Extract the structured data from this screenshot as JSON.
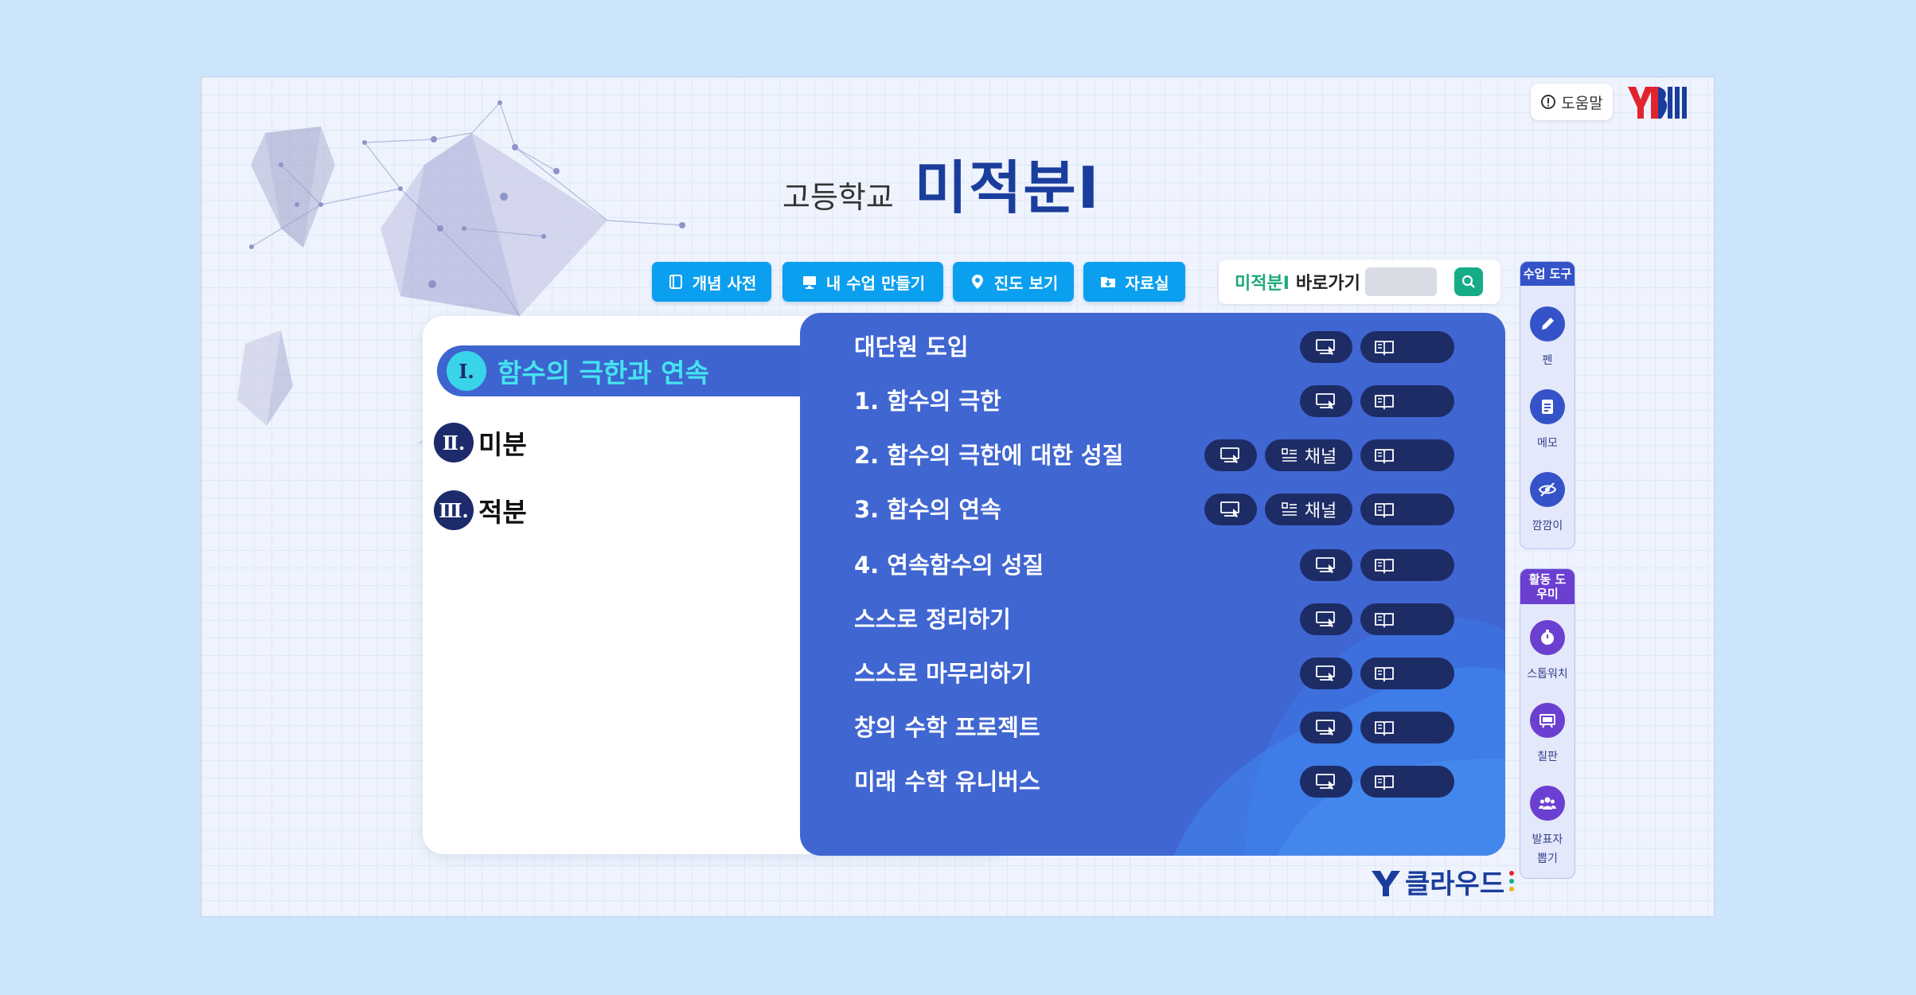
{
  "header": {
    "help_label": "도움말",
    "logo_name": "YBM",
    "title_sub": "고등학교",
    "title_main": "미적분I"
  },
  "toolbar": {
    "buttons": [
      {
        "label": "개념 사전",
        "icon": "book-icon"
      },
      {
        "label": "내 수업 만들기",
        "icon": "monitor-icon"
      },
      {
        "label": "진도 보기",
        "icon": "location-pin-icon"
      },
      {
        "label": "자료실",
        "icon": "folder-download-icon"
      }
    ],
    "search": {
      "subject": "미적분I",
      "label": "바로가기",
      "placeholder": ""
    }
  },
  "chapters": [
    {
      "num": "Ⅰ.",
      "label": "함수의 극한과 연속",
      "active": true
    },
    {
      "num": "Ⅱ.",
      "label": "미분",
      "active": false
    },
    {
      "num": "Ⅲ.",
      "label": "적분",
      "active": false
    }
  ],
  "lessons": [
    {
      "title": "대단원 도입",
      "channel": false
    },
    {
      "title": "1. 함수의 극한",
      "channel": false
    },
    {
      "title": "2. 함수의 극한에 대한 성질",
      "channel": true
    },
    {
      "title": "3. 함수의 연속",
      "channel": true
    },
    {
      "title": "4. 연속함수의 성질",
      "channel": false
    },
    {
      "title": "스스로 정리하기",
      "channel": false
    },
    {
      "title": "스스로 마무리하기",
      "channel": false
    },
    {
      "title": "창의 수학 프로젝트",
      "channel": false
    },
    {
      "title": "미래 수학 유니버스",
      "channel": false
    }
  ],
  "lesson_buttons": {
    "channel_label": "채널",
    "icons": [
      "presentation-icon",
      "list-icon",
      "open-book-icon"
    ]
  },
  "brand": {
    "cloud_logo": "클라우드"
  },
  "side_tools": {
    "class_header": "수업 도구",
    "class_tools": [
      {
        "label": "펜",
        "icon": "pen-icon"
      },
      {
        "label": "메모",
        "icon": "memo-icon"
      },
      {
        "label": "깜깜이",
        "icon": "eye-off-icon"
      }
    ],
    "activity_header": "활동 도우미",
    "activity_tools": [
      {
        "label": "스톱워치",
        "icon": "stopwatch-icon"
      },
      {
        "label": "칠판",
        "icon": "blackboard-icon"
      },
      {
        "label": "발표자 뽑기",
        "icon": "people-icon"
      }
    ]
  },
  "colors": {
    "accent_blue": "#0b9ff0",
    "panel_blue": "#4066d2",
    "navy": "#1e2c66",
    "active_cyan": "#45e3f0",
    "search_green": "#16ac87",
    "tool_blue": "#3553c8",
    "tool_purple": "#6b3fd0"
  }
}
